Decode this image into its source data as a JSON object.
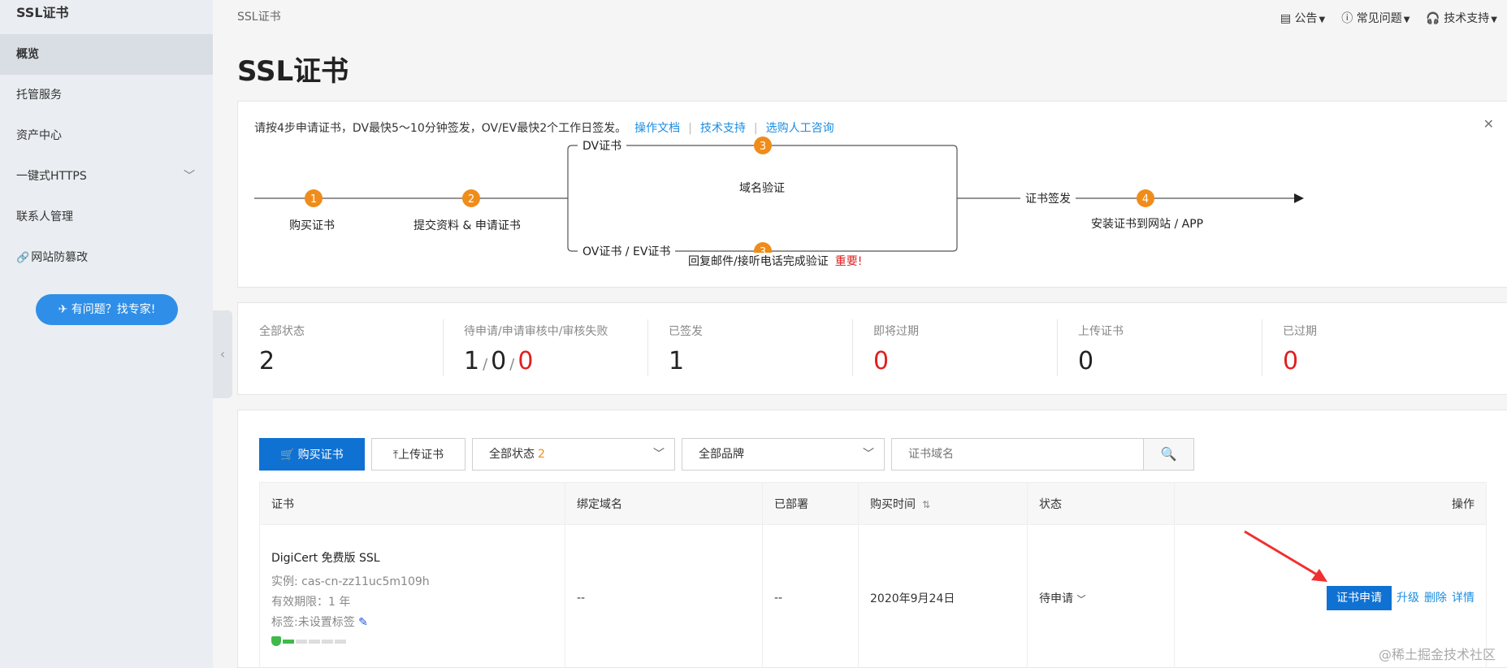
{
  "sidebar": {
    "title": "SSL证书",
    "items": [
      {
        "label": "概览",
        "active": true
      },
      {
        "label": "托管服务"
      },
      {
        "label": "资产中心"
      },
      {
        "label": "一键式HTTPS",
        "has_submenu": true
      },
      {
        "label": "联系人管理"
      },
      {
        "label": "网站防篡改",
        "icon": "link-icon"
      }
    ],
    "expert_button": "有问题？找专家!"
  },
  "breadcrumb": "SSL证书",
  "topnav": [
    {
      "label": "公告",
      "icon": "announcement-icon"
    },
    {
      "label": "常见问题",
      "icon": "help-icon"
    },
    {
      "label": "技术支持",
      "icon": "headset-icon"
    }
  ],
  "page_title": "SSL证书",
  "steps": {
    "intro": "请按4步申请证书，DV最快5～10分钟签发，OV/EV最快2个工作日签发。",
    "links": [
      "操作文档",
      "技术支持",
      "选购人工咨询"
    ],
    "step1": "购买证书",
    "step2": "提交资料 & 申请证书",
    "dv_label": "DV证书",
    "dv_step": "域名验证",
    "ov_label": "OV证书 / EV证书",
    "ov_step": "回复邮件/接听电话完成验证",
    "ov_important": "重要!",
    "issue_label": "证书签发",
    "step4": "安装证书到网站 / APP",
    "num1": "1",
    "num2": "2",
    "num3": "3",
    "num4": "4",
    "accent": "#f08c1a"
  },
  "stats": [
    {
      "title": "全部状态",
      "value": "2"
    },
    {
      "title": "待申请/申请审核中/审核失败",
      "values": [
        "1",
        "0",
        "0"
      ]
    },
    {
      "title": "已签发",
      "value": "1"
    },
    {
      "title": "即将过期",
      "value": "0",
      "red": true
    },
    {
      "title": "上传证书",
      "value": "0"
    },
    {
      "title": "已过期",
      "value": "0",
      "red": true
    }
  ],
  "toolbar": {
    "buy": "购买证书",
    "upload": "上传证书",
    "status_select": "全部状态",
    "status_count": "2",
    "brand_select": "全部品牌",
    "search_placeholder": "证书域名"
  },
  "table": {
    "headers": [
      "证书",
      "绑定域名",
      "已部署",
      "购买时间",
      "状态",
      "操作"
    ],
    "row": {
      "name": "DigiCert 免费版 SSL",
      "instance": "实例: cas-cn-zz11uc5m109h",
      "validity": "有效期限：1 年",
      "tag": "标签:未设置标签",
      "domain": "--",
      "deployed": "--",
      "date": "2020年9月24日",
      "status": "待申请",
      "actions": {
        "apply": "证书申请",
        "upgrade": "升级",
        "delete": "删除",
        "detail": "详情"
      }
    }
  },
  "watermark": "@稀土掘金技术社区"
}
